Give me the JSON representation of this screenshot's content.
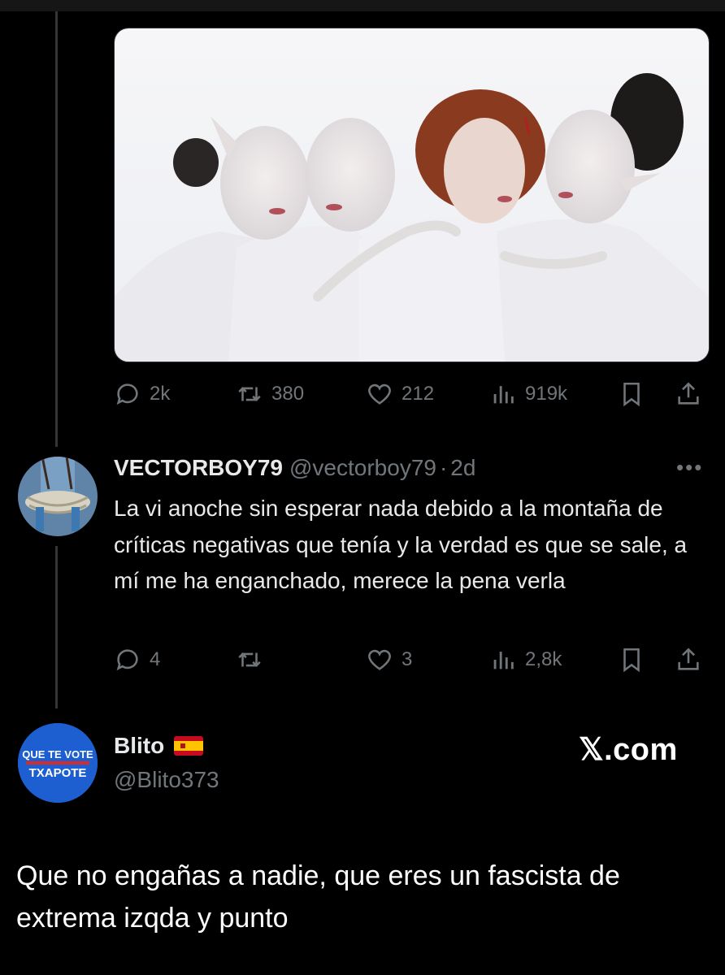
{
  "original_tweet": {
    "stats": {
      "replies": "2k",
      "retweets": "380",
      "likes": "212",
      "views": "919k"
    }
  },
  "reply": {
    "display_name": "VECTORBOY79",
    "handle": "@vectorboy79",
    "separator": "·",
    "time": "2d",
    "more_icon": "more-dots-icon",
    "text": "La vi anoche sin esperar nada debido a la montaña de críticas negativas que tenía y la verdad es que se sale, a mí me ha enganchado, merece la pena verla",
    "stats": {
      "replies": "4",
      "retweets": "",
      "likes": "3",
      "views": "2,8k"
    }
  },
  "quote": {
    "display_name": "Blito",
    "flag": "spain-flag-icon",
    "handle": "@Blito373",
    "watermark": "𝕏.com",
    "avatar_text_line1": "QUE TE VOTE",
    "avatar_text_line2": "TXAPOTE",
    "text": "Que no engañas a nadie, que eres un fascista de extrema izqda y punto"
  },
  "colors": {
    "background": "#000000",
    "text": "#e7e9ea",
    "muted": "#71767b",
    "thread_line": "#333639",
    "avatar_blue": "#1d5fd0"
  }
}
